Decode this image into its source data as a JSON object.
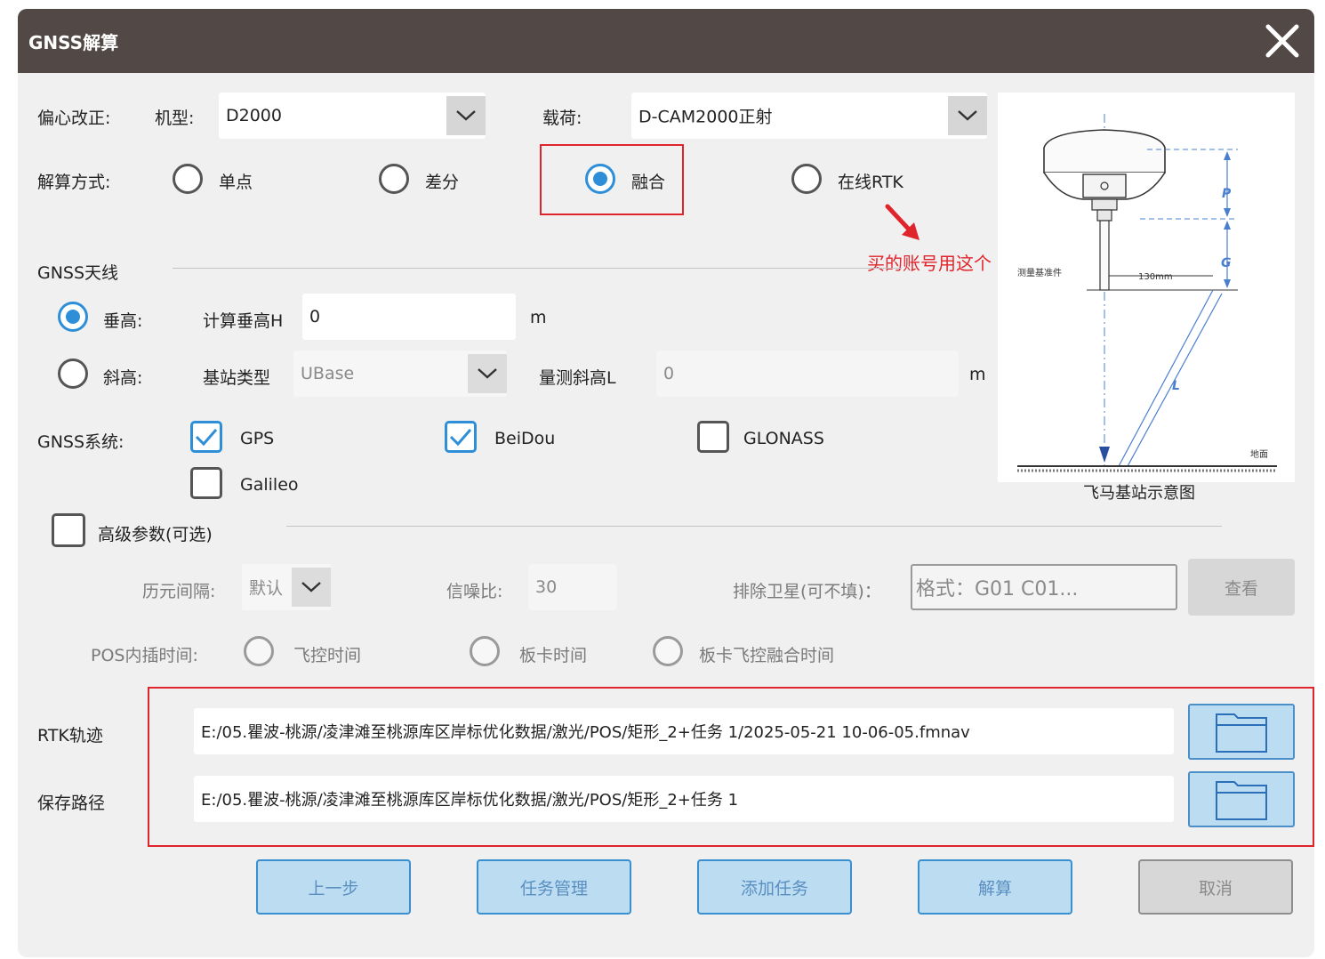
{
  "window": {
    "title": "GNSS解算"
  },
  "offset": {
    "label": "偏心改正:",
    "model_label": "机型:",
    "model_value": "D2000",
    "payload_label": "载荷:",
    "payload_value": "D-CAM2000正射"
  },
  "solve_mode": {
    "label": "解算方式:",
    "options": [
      "单点",
      "差分",
      "融合",
      "在线RTK"
    ],
    "selected": "融合"
  },
  "annotation": {
    "text": "买的账号用这个"
  },
  "antenna": {
    "section": "GNSS天线",
    "vertical_label": "垂高:",
    "calc_height_label": "计算垂高H",
    "calc_height_value": "0",
    "unit": "m",
    "slant_label": "斜高:",
    "base_type_label": "基站类型",
    "base_type_value": "UBase",
    "slant_measure_label": "量测斜高L",
    "slant_measure_value": "0",
    "slant_unit": "m",
    "selected": "垂高"
  },
  "gnss_system": {
    "label": "GNSS系统:",
    "items": [
      {
        "name": "GPS",
        "checked": true
      },
      {
        "name": "BeiDou",
        "checked": true
      },
      {
        "name": "GLONASS",
        "checked": false
      },
      {
        "name": "Galileo",
        "checked": false
      }
    ]
  },
  "advanced": {
    "label": "高级参数(可选)",
    "epoch_label": "历元间隔:",
    "epoch_value": "默认",
    "snr_label": "信噪比:",
    "snr_value": "30",
    "exclude_label": "排除卫星(可不填)：",
    "exclude_placeholder": "格式：G01 C01...",
    "view_button": "查看",
    "pos_interp_label": "POS内插时间:",
    "pos_options": [
      "飞控时间",
      "板卡时间",
      "板卡飞控融合时间"
    ]
  },
  "diagram": {
    "caption": "飞马基站示意图",
    "p_label": "P",
    "g_label": "G",
    "l_label": "L",
    "dim_label": "130mm",
    "ref_label": "测量基准件",
    "ground_label": "地面"
  },
  "paths": {
    "rtk_label": "RTK轨迹",
    "rtk_value": "E:/05.瞿波-桃源/凌津滩至桃源库区岸标优化数据/激光/POS/矩形_2+任务 1/2025-05-21 10-06-05.fmnav",
    "save_label": "保存路径",
    "save_value": "E:/05.瞿波-桃源/凌津滩至桃源库区岸标优化数据/激光/POS/矩形_2+任务 1"
  },
  "buttons": {
    "prev": "上一步",
    "task_mgmt": "任务管理",
    "add_task": "添加任务",
    "solve": "解算",
    "cancel": "取消"
  },
  "colors": {
    "titlebar": "#524946",
    "accent": "#2e8fd8",
    "highlight": "#e0242b",
    "button_fill": "#bcdcf2"
  }
}
